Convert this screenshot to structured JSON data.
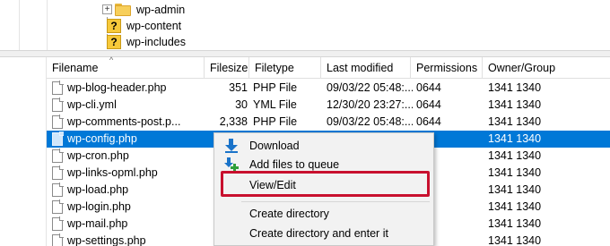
{
  "tree": {
    "items": [
      {
        "label": "wp-admin",
        "icon": "folder-icon",
        "expandable": true,
        "expander": "+"
      },
      {
        "label": "wp-content",
        "icon": "unknown-folder-icon",
        "expandable": false
      },
      {
        "label": "wp-includes",
        "icon": "unknown-folder-icon",
        "expandable": false
      }
    ]
  },
  "file_list": {
    "columns": [
      "Filename",
      "Filesize",
      "Filetype",
      "Last modified",
      "Permissions",
      "Owner/Group"
    ],
    "rows": [
      {
        "name": "wp-blog-header.php",
        "size": "351",
        "type": "PHP File",
        "modified": "09/03/22 05:48:...",
        "perms": "0644",
        "owner": "1341 1340"
      },
      {
        "name": "wp-cli.yml",
        "size": "30",
        "type": "YML File",
        "modified": "12/30/20 23:27:...",
        "perms": "0644",
        "owner": "1341 1340"
      },
      {
        "name": "wp-comments-post.p...",
        "size": "2,338",
        "type": "PHP File",
        "modified": "09/03/22 05:48:...",
        "perms": "0644",
        "owner": "1341 1340"
      },
      {
        "name": "wp-config.php",
        "size": "",
        "type": "",
        "modified": "",
        "perms": "4",
        "owner": "1341 1340",
        "selected": true
      },
      {
        "name": "wp-cron.php",
        "size": "",
        "type": "",
        "modified": "",
        "perms": "4",
        "owner": "1341 1340"
      },
      {
        "name": "wp-links-opml.php",
        "size": "",
        "type": "",
        "modified": "",
        "perms": "4",
        "owner": "1341 1340"
      },
      {
        "name": "wp-load.php",
        "size": "",
        "type": "",
        "modified": "",
        "perms": "4",
        "owner": "1341 1340"
      },
      {
        "name": "wp-login.php",
        "size": "",
        "type": "",
        "modified": "",
        "perms": "4",
        "owner": "1341 1340"
      },
      {
        "name": "wp-mail.php",
        "size": "",
        "type": "",
        "modified": "",
        "perms": "4",
        "owner": "1341 1340"
      },
      {
        "name": "wp-settings.php",
        "size": "",
        "type": "",
        "modified": "",
        "perms": "4",
        "owner": "1341 1340"
      }
    ]
  },
  "context_menu": {
    "download": "Download",
    "add_to_queue": "Add files to queue",
    "view_edit": "View/Edit",
    "create_directory": "Create directory",
    "create_directory_enter": "Create directory and enter it"
  },
  "colors": {
    "selection": "#0078d7",
    "highlight_box": "#c8102e",
    "menu_background": "#f2f2f2"
  }
}
